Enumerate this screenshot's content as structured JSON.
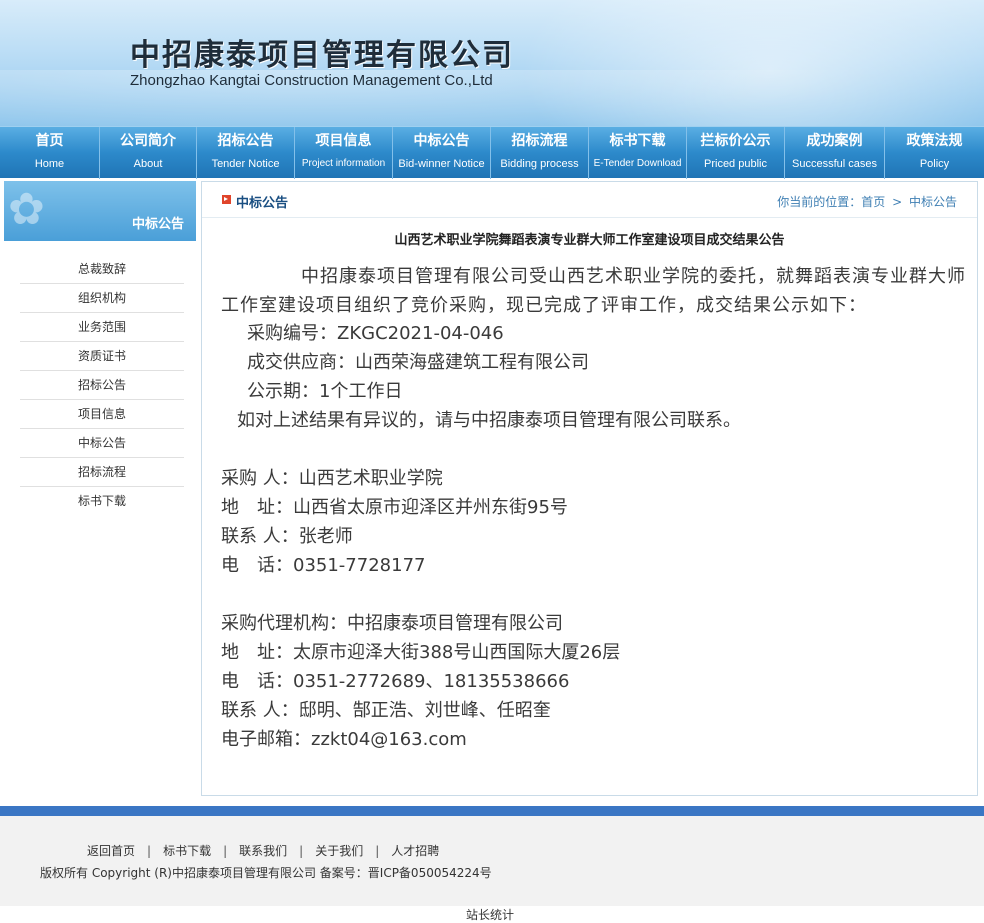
{
  "header": {
    "company_cn": "中招康泰项目管理有限公司",
    "company_en": "Zhongzhao Kangtai Construction Management Co.,Ltd"
  },
  "nav": [
    {
      "cn": "首页",
      "en": "Home"
    },
    {
      "cn": "公司简介",
      "en": "About"
    },
    {
      "cn": "招标公告",
      "en": "Tender Notice"
    },
    {
      "cn": "项目信息",
      "en": "Project information"
    },
    {
      "cn": "中标公告",
      "en": "Bid-winner Notice"
    },
    {
      "cn": "招标流程",
      "en": "Bidding process"
    },
    {
      "cn": "标书下载",
      "en": "E-Tender Download"
    },
    {
      "cn": "拦标价公示",
      "en": "Priced public"
    },
    {
      "cn": "成功案例",
      "en": "Successful cases"
    },
    {
      "cn": "政策法规",
      "en": "Policy"
    }
  ],
  "sidebar": {
    "title": "中标公告",
    "items": [
      "总裁致辞",
      "组织机构",
      "业务范围",
      "资质证书",
      "招标公告",
      "项目信息",
      "中标公告",
      "招标流程",
      "标书下载"
    ]
  },
  "main": {
    "section_title": "中标公告",
    "breadcrumb": {
      "prefix": "你当前的位置：",
      "home": "首页",
      "sep": ">",
      "current": "中标公告"
    },
    "article_title": "山西艺术职业学院舞蹈表演专业群大师工作室建设项目成交结果公告",
    "paragraph": "中招康泰项目管理有限公司受山西艺术职业学院的委托，就舞蹈表演专业群大师工作室建设项目组织了竞价采购，现已完成了评审工作，成交结果公示如下：",
    "purchase_no": "采购编号：ZKGC2021-04-046",
    "supplier": "成交供应商：山西荣海盛建筑工程有限公司",
    "period": "公示期：1个工作日",
    "objection": "如对上述结果有异议的，请与中招康泰项目管理有限公司联系。",
    "buyer": "采购 人：山西艺术职业学院",
    "buyer_addr": "地　址：山西省太原市迎泽区并州东街95号",
    "buyer_contact": "联系 人：张老师",
    "buyer_tel": "电　话：0351-7728177",
    "agent": "采购代理机构：中招康泰项目管理有限公司",
    "agent_addr": "地　址：太原市迎泽大街388号山西国际大厦26层",
    "agent_tel": "电　话：0351-2772689、18135538666",
    "agent_contact": "联系 人：邸明、郜正浩、刘世峰、任昭奎",
    "agent_email": "电子邮箱：zzkt04@163.com"
  },
  "footer": {
    "links": [
      "返回首页",
      "标书下载",
      "联系我们",
      "关于我们",
      "人才招聘"
    ],
    "separator": "|",
    "copyright": "版权所有 Copyright (R)中招康泰项目管理有限公司 备案号：晋ICP备050054224号",
    "stats": "站长统计"
  }
}
